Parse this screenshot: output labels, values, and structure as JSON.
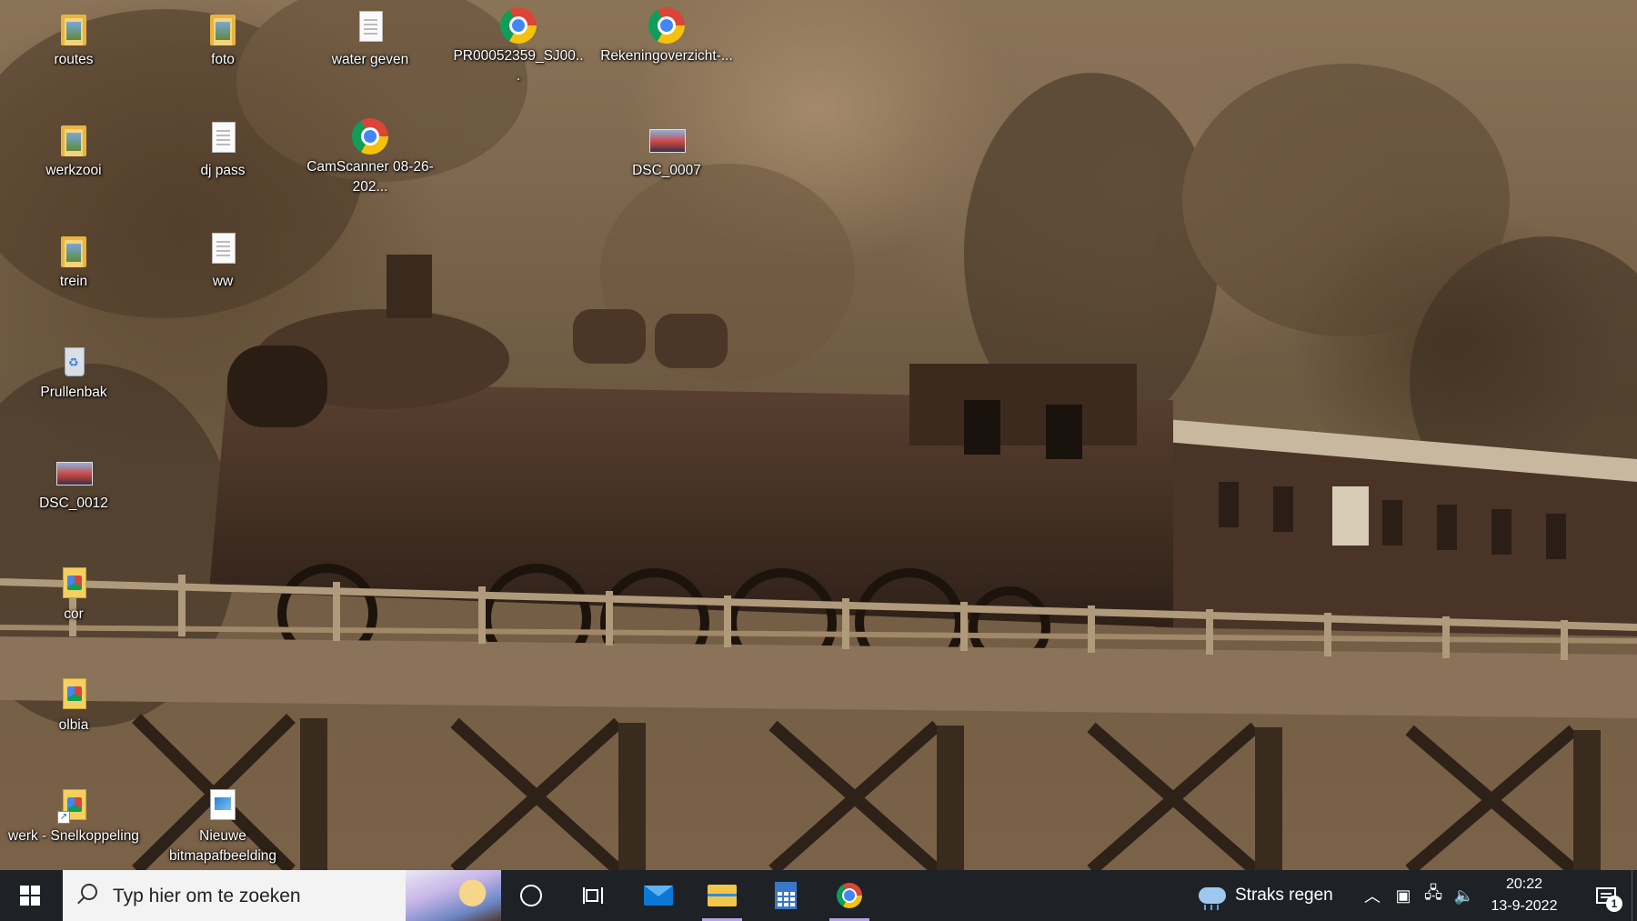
{
  "desktop": {
    "icons": [
      {
        "label": "routes",
        "type": "folder"
      },
      {
        "label": "foto",
        "type": "folder"
      },
      {
        "label": "water geven",
        "type": "text-document"
      },
      {
        "label": "PR00052359_SJ00...",
        "type": "chrome-shortcut"
      },
      {
        "label": "Rekeningoverzicht-...",
        "type": "chrome-shortcut"
      },
      {
        "label": "werkzooi",
        "type": "folder"
      },
      {
        "label": "dj pass",
        "type": "text-document"
      },
      {
        "label": "CamScanner 08-26-202...",
        "type": "chrome-shortcut"
      },
      {
        "label": "DSC_0007",
        "type": "photo"
      },
      {
        "label": "trein",
        "type": "folder"
      },
      {
        "label": "ww",
        "type": "text-document"
      },
      {
        "label": "Prullenbak",
        "type": "recycle-bin"
      },
      {
        "label": "DSC_0012",
        "type": "photo"
      },
      {
        "label": "cor",
        "type": "zip-folder"
      },
      {
        "label": "olbia",
        "type": "zip-folder"
      },
      {
        "label": "werk - Snelkoppeling",
        "type": "zip-shortcut"
      },
      {
        "label": "Nieuwe bitmapafbeelding",
        "type": "bitmap"
      }
    ]
  },
  "taskbar": {
    "search_placeholder": "Typ hier om te zoeken",
    "pinned": [
      {
        "name": "cortana",
        "icon": "circle-icon"
      },
      {
        "name": "task-view",
        "icon": "task-view-icon"
      },
      {
        "name": "mail",
        "icon": "mail-icon"
      },
      {
        "name": "file-explorer",
        "icon": "folder-icon"
      },
      {
        "name": "calculator",
        "icon": "calculator-icon"
      },
      {
        "name": "chrome",
        "icon": "chrome-icon"
      }
    ],
    "weather_text": "Straks regen",
    "time": "20:22",
    "date": "13-9-2022",
    "notification_count": "1",
    "active_color": "#b8a2e6"
  }
}
